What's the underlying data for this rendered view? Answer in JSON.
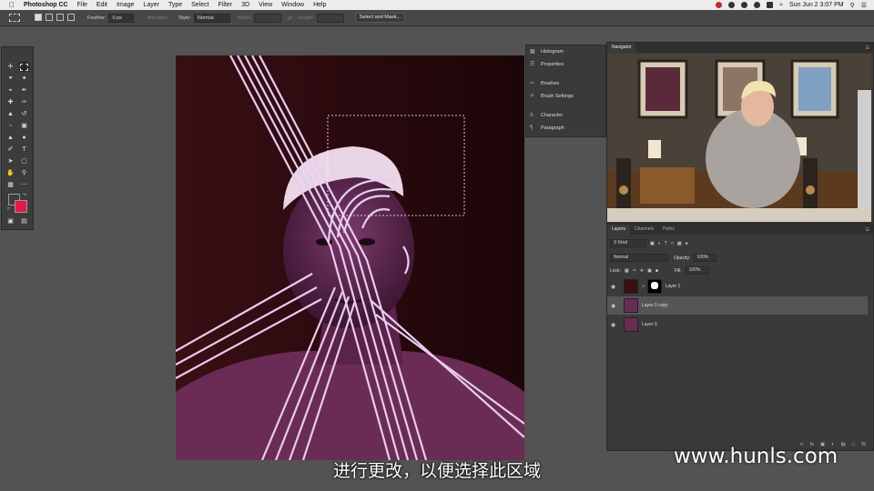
{
  "menubar": {
    "app": "Photoshop CC",
    "items": [
      "File",
      "Edit",
      "Image",
      "Layer",
      "Type",
      "Select",
      "Filter",
      "3D",
      "View",
      "Window",
      "Help"
    ],
    "clock": "Sun Jun 2  3:07 PM"
  },
  "options": {
    "feather_label": "Feather:",
    "feather_value": "0 px",
    "antialias_label": "Anti-alias",
    "style_label": "Style:",
    "style_value": "Normal",
    "width_label": "Width:",
    "height_label": "Height:",
    "select_mask_button": "Select and Mask..."
  },
  "panel_strip": {
    "items": [
      {
        "label": "Histogram",
        "icon": "histogram-icon"
      },
      {
        "label": "Properties",
        "icon": "properties-icon"
      },
      {
        "label": "Brushes",
        "icon": "brushes-icon"
      },
      {
        "label": "Brush Settings",
        "icon": "brush-settings-icon"
      },
      {
        "label": "Character",
        "icon": "character-icon"
      },
      {
        "label": "Paragraph",
        "icon": "paragraph-icon"
      }
    ]
  },
  "navigator": {
    "title": "Navigator"
  },
  "layers_panel": {
    "tabs": [
      "Layers",
      "Channels",
      "Paths"
    ],
    "kind_filter": "Kind",
    "blend_mode": "Normal",
    "opacity_label": "Opacity:",
    "opacity_value": "100%",
    "lock_label": "Lock:",
    "fill_label": "Fill:",
    "fill_value": "100%",
    "layers": [
      {
        "name": "Layer 1",
        "selected": false,
        "has_mask": true
      },
      {
        "name": "Layer 0 copy",
        "selected": true,
        "has_mask": false
      },
      {
        "name": "Layer 0",
        "selected": false,
        "has_mask": false
      }
    ]
  },
  "subtitle": "进行更改，以便选择此区域",
  "watermark": "www.hunls.com",
  "colors": {
    "foreground": "#3a3a3a",
    "background_swatch": "#e8174c",
    "canvas_bg": "#2a0b0e",
    "line_art": "#e6cdf0"
  }
}
